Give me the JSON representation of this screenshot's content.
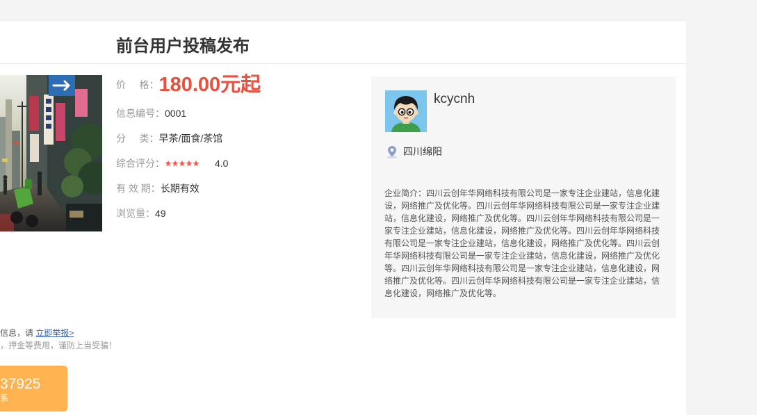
{
  "colors": {
    "page_bg": "#f4f4f4",
    "panel_bg": "#ffffff",
    "price_red": "#e8513e",
    "star_filled": "#f15a47",
    "seller_card_bg": "#f6f6f6",
    "report_link_blue": "#3a66b3",
    "contact_button_orange": "#ffb24f"
  },
  "listing": {
    "title": "前台用户投稿发布",
    "photo_icon": "street-scene-photo",
    "details": {
      "price": {
        "label": "价     格：",
        "value": "180.00元起"
      },
      "info_id": {
        "label": "信息编号：",
        "value": "0001"
      },
      "category": {
        "label": "分     类：",
        "value": "早茶/面食/茶馆"
      },
      "rating": {
        "label": "综合评分：",
        "stars_filled": 5,
        "stars_total": 5,
        "value": "4.0"
      },
      "validity": {
        "label": "有 效 期：",
        "value": "长期有效"
      },
      "views": {
        "label": "浏览量：",
        "value": "49"
      }
    }
  },
  "seller": {
    "avatar_icon": "cartoon-boy-avatar",
    "username": "kcycnh",
    "location_icon": "map-pin-icon",
    "location": "四川绵阳",
    "intro": "企业简介：四川云创年华网络科技有限公司是一家专注企业建站，信息化建设，网络推广及优化等。四川云创年华网络科技有限公司是一家专注企业建站，信息化建设，网络推广及优化等。四川云创年华网络科技有限公司是一家专注企业建站，信息化建设，网络推广及优化等。四川云创年华网络科技有限公司是一家专注企业建站，信息化建设，网络推广及优化等。四川云创年华网络科技有限公司是一家专注企业建站，信息化建设，网络推广及优化等。四川云创年华网络科技有限公司是一家专注企业建站，信息化建设，网络推广及优化等。四川云创年华网络科技有限公司是一家专注企业建站，信息化建设，网络推广及优化等。"
  },
  "notice": {
    "line1_text": "信息，请 ",
    "report_link": "立即举报>",
    "line2_text": "，押金等费用，谨防上当受骗！"
  },
  "contact_button": {
    "phone": "37925",
    "label": "系"
  }
}
